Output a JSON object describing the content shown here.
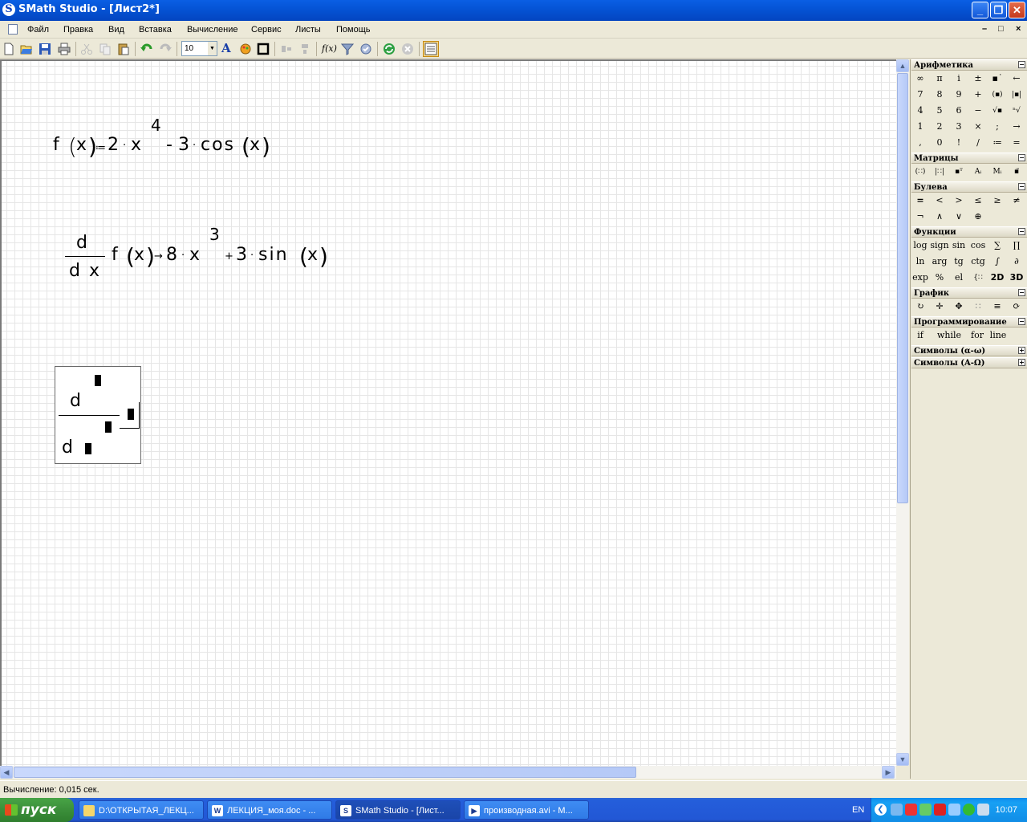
{
  "window": {
    "app_letter": "S",
    "title": "SMath Studio - [Лист2*]"
  },
  "menu": [
    "Файл",
    "Правка",
    "Вид",
    "Вставка",
    "Вычисление",
    "Сервис",
    "Листы",
    "Помощь"
  ],
  "mdi_buttons": [
    "–",
    "□",
    "×"
  ],
  "toolbar": {
    "font_size": "10",
    "icons": [
      "new-icon",
      "open-icon",
      "save-icon",
      "print-icon",
      "cut-icon",
      "copy-icon",
      "paste-icon",
      "undo-icon",
      "redo-icon",
      "text-format-icon",
      "color-icon",
      "border-icon",
      "align-left-icon",
      "align-center-icon",
      "function-icon",
      "filter-icon",
      "dynamic-assistant-icon",
      "recalculate-icon",
      "stop-icon",
      "sheet-view-icon"
    ],
    "function_label": "f(x)",
    "text_label": "A"
  },
  "worksheet": {
    "expr1": {
      "lhs": "f",
      "arg": "x",
      "op": "≔",
      "c1": "2",
      "dot": "·",
      "var": "x",
      "exp": "4",
      "minus": "-",
      "c2": "3",
      "fn": "cos",
      "arg2": "x"
    },
    "expr2": {
      "d": "d",
      "dx": "d x",
      "fn": "f",
      "arg": "x",
      "arrow": "→",
      "c1": "8",
      "dot": "·",
      "var": "x",
      "exp": "3",
      "plus": "+",
      "c2": "3",
      "fn2": "sin",
      "arg2": "x"
    },
    "expr3": {
      "d_top": "d",
      "d_bottom": "d"
    }
  },
  "panel": {
    "groups": [
      {
        "title": "Арифметика",
        "toggle": "−"
      },
      {
        "title": "Матрицы",
        "toggle": "−"
      },
      {
        "title": "Булева",
        "toggle": "−"
      },
      {
        "title": "Функции",
        "toggle": "−"
      },
      {
        "title": "График",
        "toggle": "−"
      },
      {
        "title": "Программирование",
        "toggle": "−"
      },
      {
        "title": "Символы (α-ω)",
        "toggle": "+"
      },
      {
        "title": "Символы (Α-Ω)",
        "toggle": "+"
      }
    ],
    "arithmetic": [
      [
        "∞",
        "π",
        "i",
        "±",
        "▪˙",
        "←"
      ],
      [
        "7",
        "8",
        "9",
        "+",
        "(▪)",
        "|▪|"
      ],
      [
        "4",
        "5",
        "6",
        "−",
        "√▪",
        "ⁿ√"
      ],
      [
        "1",
        "2",
        "3",
        "×",
        ";",
        "→"
      ],
      [
        ",",
        "0",
        "!",
        "/",
        "≔",
        "="
      ]
    ],
    "matrices": [
      "(∷)",
      "|∷|",
      "▪ᵀ",
      "Aᵢ",
      "Mᵢ",
      "▪⃗"
    ],
    "boolean": [
      [
        "=",
        "<",
        ">",
        "≤",
        "≥",
        "≠"
      ],
      [
        "¬",
        "∧",
        "∨",
        "⊕"
      ]
    ],
    "functions": [
      [
        "log",
        "sign",
        "sin",
        "cos",
        "∑",
        "∏"
      ],
      [
        "ln",
        "arg",
        "tg",
        "ctg",
        "∫",
        "∂"
      ],
      [
        "exp",
        "%",
        "el",
        "{∷",
        "2D",
        "3D"
      ]
    ],
    "graph": [
      "↻",
      "✛",
      "✥",
      "∷",
      "≡",
      "⟳"
    ],
    "programming": [
      "if",
      "while",
      "for",
      "line"
    ]
  },
  "status": "Вычисление: 0,015 сек.",
  "taskbar": {
    "start": "пуск",
    "tasks": [
      {
        "label": "D:\\ОТКРЫТАЯ_ЛЕКЦ...",
        "icon": "folder"
      },
      {
        "label": "ЛЕКЦИЯ_моя.doc - ...",
        "icon": "W"
      },
      {
        "label": "SMath Studio - [Лист...",
        "icon": "S"
      },
      {
        "label": "производная.avi - M...",
        "icon": "▶"
      }
    ],
    "lang": "EN",
    "clock": "10:07"
  },
  "colors": {
    "titlebar": "#0554d6",
    "taskbar": "#245edb",
    "start": "#3b8f3a",
    "tray": "#17a0f4"
  }
}
